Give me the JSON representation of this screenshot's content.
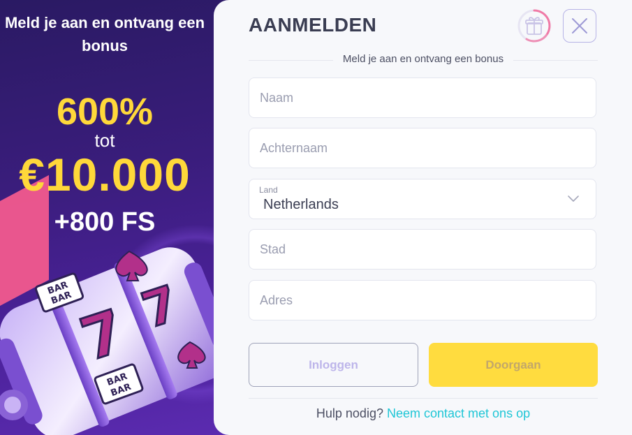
{
  "promo": {
    "headline": "Meld je aan en ontvang een bonus",
    "percent": "600%",
    "tot": "tot",
    "amount": "€10.000",
    "free_spins": "+800 FS",
    "reel_symbols": [
      "BAR",
      "BAR",
      "7"
    ]
  },
  "modal": {
    "title": "AANMELDEN",
    "subtitle": "Meld je aan en ontvang een bonus",
    "fields": {
      "first_name": {
        "placeholder": "Naam",
        "value": ""
      },
      "last_name": {
        "placeholder": "Achternaam",
        "value": ""
      },
      "country": {
        "label": "Land",
        "value": "Netherlands"
      },
      "city": {
        "placeholder": "Stad",
        "value": ""
      },
      "address": {
        "placeholder": "Adres",
        "value": ""
      }
    },
    "buttons": {
      "login": "Inloggen",
      "continue": "Doorgaan"
    },
    "help": {
      "text": "Hulp nodig?",
      "link": "Neem contact met ons op"
    }
  },
  "icons": {
    "gift": "gift-icon",
    "close": "close-icon",
    "chevron": "chevron-down-icon"
  },
  "colors": {
    "accent_yellow": "#ffdc3f",
    "promo_gold": "#ffd83a",
    "link_cyan": "#1fc6d6",
    "close_border": "#b6b3e6",
    "gift_ring_pink": "#f07aa6"
  }
}
